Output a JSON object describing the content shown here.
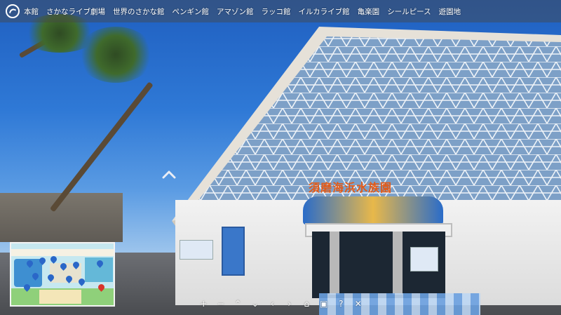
{
  "topbar": {
    "logo_icon": "aquarium-logo-icon",
    "menu": [
      {
        "label": "本館"
      },
      {
        "label": "さかなライブ劇場"
      },
      {
        "label": "世界のさかな館"
      },
      {
        "label": "ペンギン館"
      },
      {
        "label": "アマゾン館"
      },
      {
        "label": "ラッコ館"
      },
      {
        "label": "イルカライブ館"
      },
      {
        "label": "亀楽園"
      },
      {
        "label": "シールピース"
      },
      {
        "label": "遊園地"
      }
    ]
  },
  "scene": {
    "building_sign": "須磨海浜水族園",
    "hotspot_icon": "chevron-up-icon"
  },
  "controls": [
    {
      "name": "zoom-in-button",
      "glyph": "+"
    },
    {
      "name": "zoom-out-button",
      "glyph": "−"
    },
    {
      "name": "look-up-button",
      "glyph": "⌃"
    },
    {
      "name": "look-down-button",
      "glyph": "⌄"
    },
    {
      "name": "look-left-button",
      "glyph": "‹"
    },
    {
      "name": "look-right-button",
      "glyph": "›"
    },
    {
      "name": "home-button",
      "glyph": "⌂"
    },
    {
      "name": "map-button",
      "glyph": "▣"
    },
    {
      "name": "help-button",
      "glyph": "?"
    },
    {
      "name": "fullscreen-button",
      "glyph": "✕"
    }
  ],
  "colors": {
    "accent_pin": "#2a67c8",
    "active_pin": "#d9342b",
    "sign": "#e35a17"
  }
}
